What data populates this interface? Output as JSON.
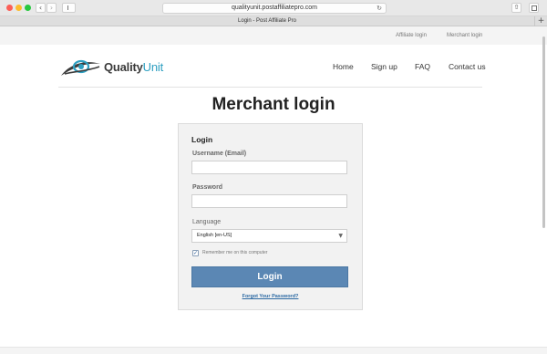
{
  "browser": {
    "url": "qualityunit.postaffiliatepro.com",
    "tab_title": "Login - Post Affiliate Pro",
    "back_glyph": "‹",
    "forward_glyph": "›",
    "reload_glyph": "↻",
    "share_glyph": "⇧",
    "new_tab_glyph": "+"
  },
  "utility_bar": {
    "affiliate_login": "Affiliate login",
    "merchant_login": "Merchant login"
  },
  "header": {
    "logo_text_main": "Quality",
    "logo_text_accent": "Unit",
    "nav": {
      "home": "Home",
      "signup": "Sign up",
      "faq": "FAQ",
      "contact": "Contact us"
    }
  },
  "page": {
    "title": "Merchant login"
  },
  "login_form": {
    "heading": "Login",
    "username_label": "Username (Email)",
    "username_value": "",
    "password_label": "Password",
    "password_value": "",
    "language_label": "Language",
    "language_selected": "English [en-US]",
    "remember_checked": true,
    "check_glyph": "✓",
    "remember_label": "Remember me on this computer",
    "submit_label": "Login",
    "forgot_link": "Forgot Your Password?"
  },
  "colors": {
    "accent": "#2e9fc1",
    "login_button": "#5b87b4",
    "link": "#2d6aa3"
  },
  "icons": {
    "logo": "eye-swoosh-icon",
    "select_arrow": "triangle-down-icon",
    "checkbox": "checkmark-icon"
  }
}
